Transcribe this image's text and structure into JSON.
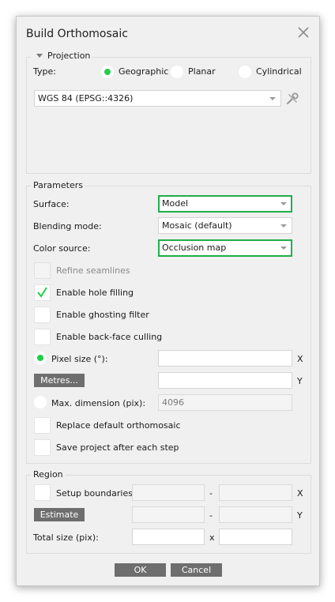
{
  "dialog": {
    "title": "Build Orthomosaic"
  },
  "projection": {
    "legend": "Projection",
    "type_label": "Type:",
    "types": [
      "Geographic",
      "Planar",
      "Cylindrical"
    ],
    "selected_type": "Geographic",
    "crs_value": "WGS 84 (EPSG::4326)"
  },
  "parameters": {
    "legend": "Parameters",
    "surface_label": "Surface:",
    "surface_value": "Model",
    "blending_label": "Blending mode:",
    "blending_value": "Mosaic (default)",
    "color_source_label": "Color source:",
    "color_source_value": "Occlusion map",
    "refine_seamlines": {
      "label": "Refine seamlines",
      "checked": false,
      "enabled": false
    },
    "enable_hole_filling": {
      "label": "Enable hole filling",
      "checked": true
    },
    "enable_ghosting_filter": {
      "label": "Enable ghosting filter",
      "checked": false
    },
    "enable_backface_culling": {
      "label": "Enable back-face culling",
      "checked": false
    },
    "pixel_size_label": "Pixel size (°):",
    "pixel_size_x": "",
    "pixel_size_y": "",
    "x_axis_label": "X",
    "y_axis_label": "Y",
    "metres_button": "Metres...",
    "max_dimension_label": "Max. dimension (pix):",
    "max_dimension_value": "4096",
    "replace_default": {
      "label": "Replace default orthomosaic",
      "checked": false
    },
    "save_project": {
      "label": "Save project after each step",
      "checked": false
    }
  },
  "region": {
    "legend": "Region",
    "setup_boundaries_label": "Setup boundaries:",
    "estimate_button": "Estimate",
    "total_size_label": "Total size (pix):",
    "range_separator": "-",
    "times_separator": "x",
    "x_label": "X",
    "y_label": "Y",
    "total_x": "",
    "total_y": ""
  },
  "buttons": {
    "ok": "OK",
    "cancel": "Cancel"
  },
  "colors": {
    "accent_green": "#1fcf4a",
    "highlight_border": "#1fae4a",
    "button_gray": "#6e6e6e"
  },
  "icons": [
    "close-icon",
    "crs-settings-icon",
    "checkmark-icon"
  ]
}
